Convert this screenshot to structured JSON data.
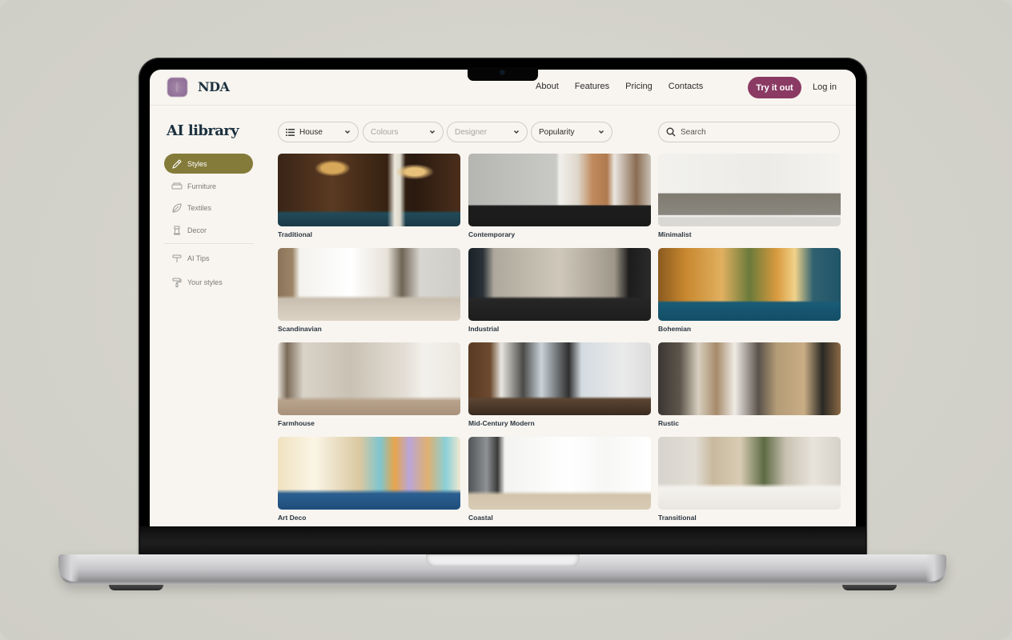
{
  "header": {
    "brand": "NDA",
    "nav": [
      "About",
      "Features",
      "Pricing",
      "Contacts"
    ],
    "cta_label": "Try it out",
    "login_label": "Log in",
    "accent_color": "#8a3a63"
  },
  "sidebar": {
    "title": "AI library",
    "active_color": "#847b3a",
    "items": [
      {
        "label": "Styles",
        "icon": "paintbrush-icon",
        "active": true
      },
      {
        "label": "Furniture",
        "icon": "sofa-icon",
        "active": false
      },
      {
        "label": "Textiles",
        "icon": "leaf-icon",
        "active": false
      },
      {
        "label": "Decor",
        "icon": "chess-rook-icon",
        "active": false
      }
    ],
    "secondary_items": [
      {
        "label": "AI Tips",
        "icon": "signpost-icon"
      },
      {
        "label": "Your styles",
        "icon": "paint-roller-icon"
      }
    ]
  },
  "filters": [
    {
      "label": "House",
      "placeholder": false,
      "icon": "list-icon"
    },
    {
      "label": "Colours",
      "placeholder": true
    },
    {
      "label": "Designer",
      "placeholder": true
    },
    {
      "label": "Popularity",
      "placeholder": false
    }
  ],
  "search": {
    "placeholder": "Search"
  },
  "styles": [
    {
      "label": "Traditional"
    },
    {
      "label": "Contemporary"
    },
    {
      "label": "Minimalist"
    },
    {
      "label": "Scandinavian"
    },
    {
      "label": "Industrial"
    },
    {
      "label": "Bohemian"
    },
    {
      "label": "Farmhouse"
    },
    {
      "label": "Mid-Century Modern"
    },
    {
      "label": "Rustic"
    },
    {
      "label": "Art Deco"
    },
    {
      "label": "Coastal"
    },
    {
      "label": "Transitional"
    }
  ]
}
